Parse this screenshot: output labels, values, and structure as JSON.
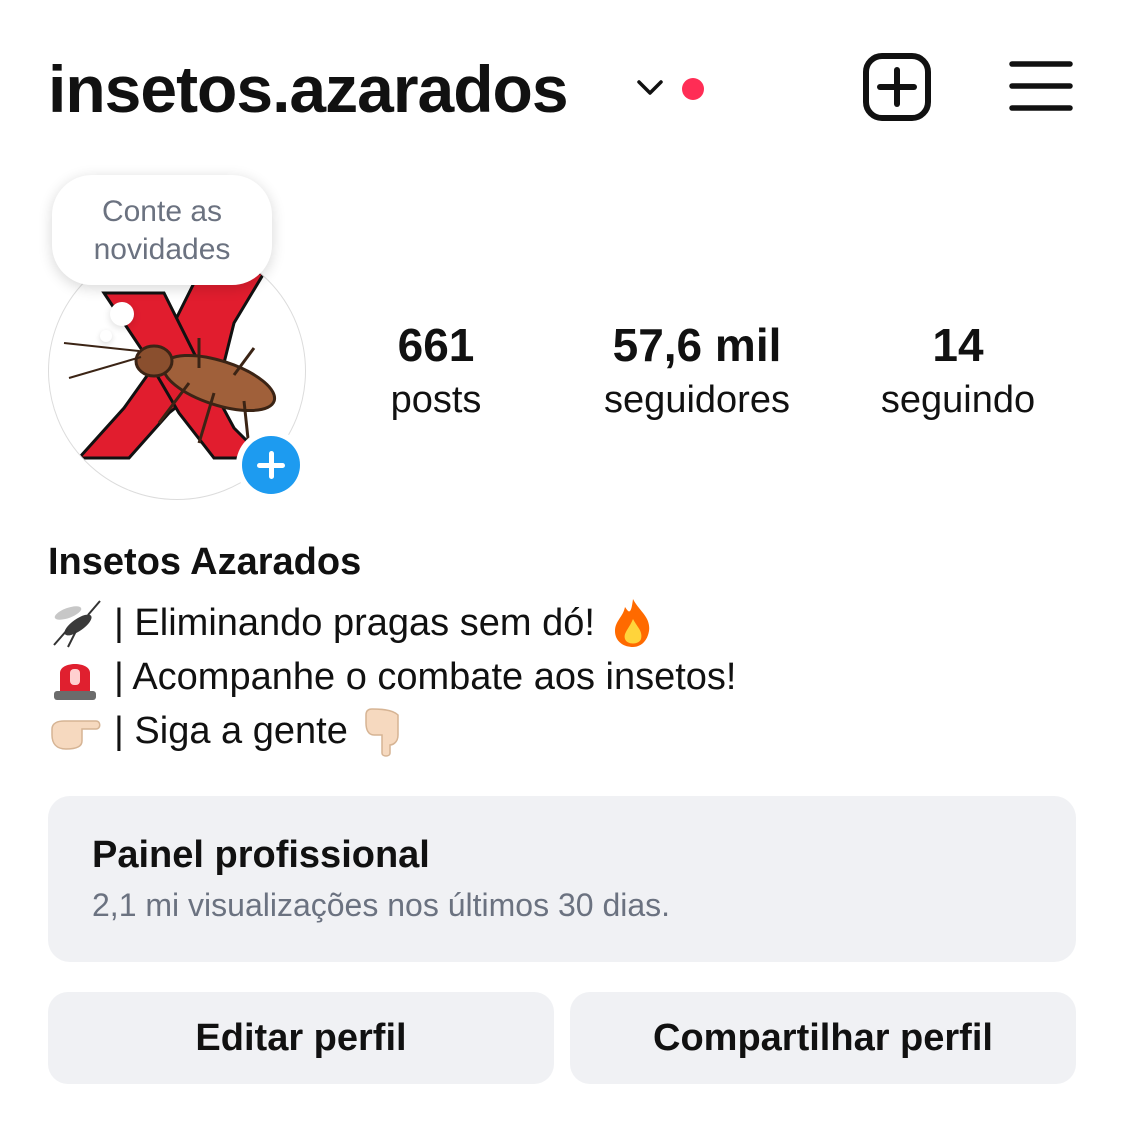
{
  "header": {
    "username": "insetos.azarados",
    "icons": [
      "chevron-down-icon",
      "notification-dot",
      "create-post-icon",
      "hamburger-menu-icon"
    ],
    "notification_color": "#ff2d55"
  },
  "note": {
    "line1": "Conte as",
    "line2": "novidades"
  },
  "avatar": {
    "icons": [
      "cockroach-icon",
      "red-x-icon"
    ],
    "badge_color": "#1d9bf0"
  },
  "stats": {
    "posts": {
      "value": "661",
      "label": "posts"
    },
    "followers": {
      "value": "57,6 mil",
      "label": "seguidores"
    },
    "following": {
      "value": "14",
      "label": "seguindo"
    }
  },
  "profile": {
    "display_name": "Insetos Azarados",
    "bio": [
      {
        "icon": "mosquito-icon",
        "text": "| Eliminando pragas sem dó!",
        "after_icon": "fire-icon"
      },
      {
        "icon": "siren-icon",
        "text": "| Acompanhe o combate aos insetos!"
      },
      {
        "icon": "pointing-right-icon",
        "text": "| Siga a gente",
        "after_icon": "pointing-down-icon"
      }
    ]
  },
  "dashboard": {
    "title": "Painel profissional",
    "subtitle": "2,1 mi visualizações nos últimos 30 dias."
  },
  "actions": {
    "edit_label": "Editar perfil",
    "share_label": "Compartilhar perfil"
  }
}
